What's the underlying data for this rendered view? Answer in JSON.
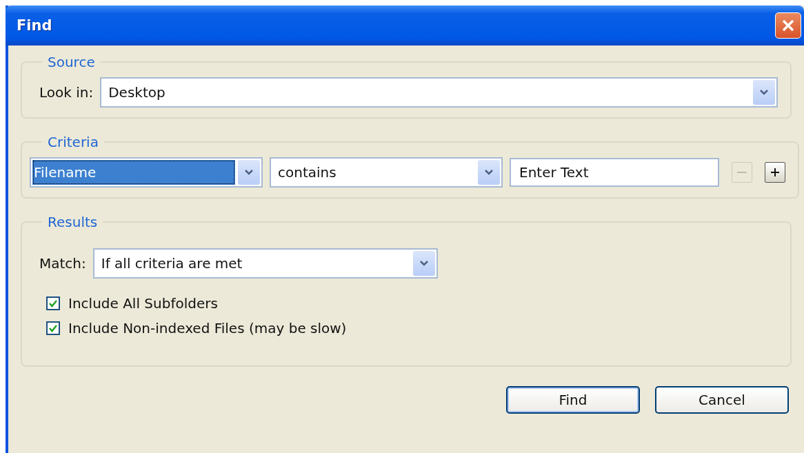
{
  "window": {
    "title": "Find"
  },
  "source": {
    "legend": "Source",
    "label": "Look in:",
    "value": "Desktop"
  },
  "criteria": {
    "legend": "Criteria",
    "rows": [
      {
        "field": {
          "value": "Filename",
          "focused": true
        },
        "operator": {
          "value": "contains"
        },
        "text": {
          "value": "Enter Text"
        },
        "remove": {
          "disabled": true
        },
        "add": {
          "disabled": false
        }
      }
    ]
  },
  "results": {
    "legend": "Results",
    "label": "Match:",
    "value": "If all criteria are met",
    "options": [
      {
        "label": "Include All Subfolders",
        "checked": true
      },
      {
        "label": "Include Non-indexed Files (may be slow)",
        "checked": true
      }
    ]
  },
  "buttons": [
    {
      "label": "Find",
      "default": true
    },
    {
      "label": "Cancel",
      "default": false
    }
  ]
}
